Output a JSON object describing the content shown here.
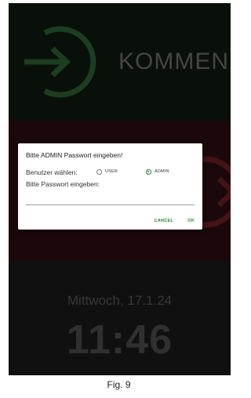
{
  "screen": {
    "kommen_label": "KOMMEN",
    "date": "Mittwoch, 17.1.24",
    "time": "11:46",
    "icons": {
      "kommen": "enter-arrow-icon",
      "gehen": "exit-arrow-icon"
    },
    "colors": {
      "kommen_accent": "#2d5e33",
      "gehen_accent": "#6a1d24"
    }
  },
  "dialog": {
    "title": "Bitte ADMIN Passwort eingeben!",
    "user_label": "Benutzer wählen:",
    "options": [
      {
        "label": "USER",
        "selected": false
      },
      {
        "label": "ADMIN",
        "selected": true
      }
    ],
    "password_label": "Bitte Passwort eingeben:",
    "password_value": "",
    "cancel_label": "CANCEL",
    "ok_label": "OK",
    "accent": "#2e7d32"
  },
  "caption": "Fig. 9"
}
